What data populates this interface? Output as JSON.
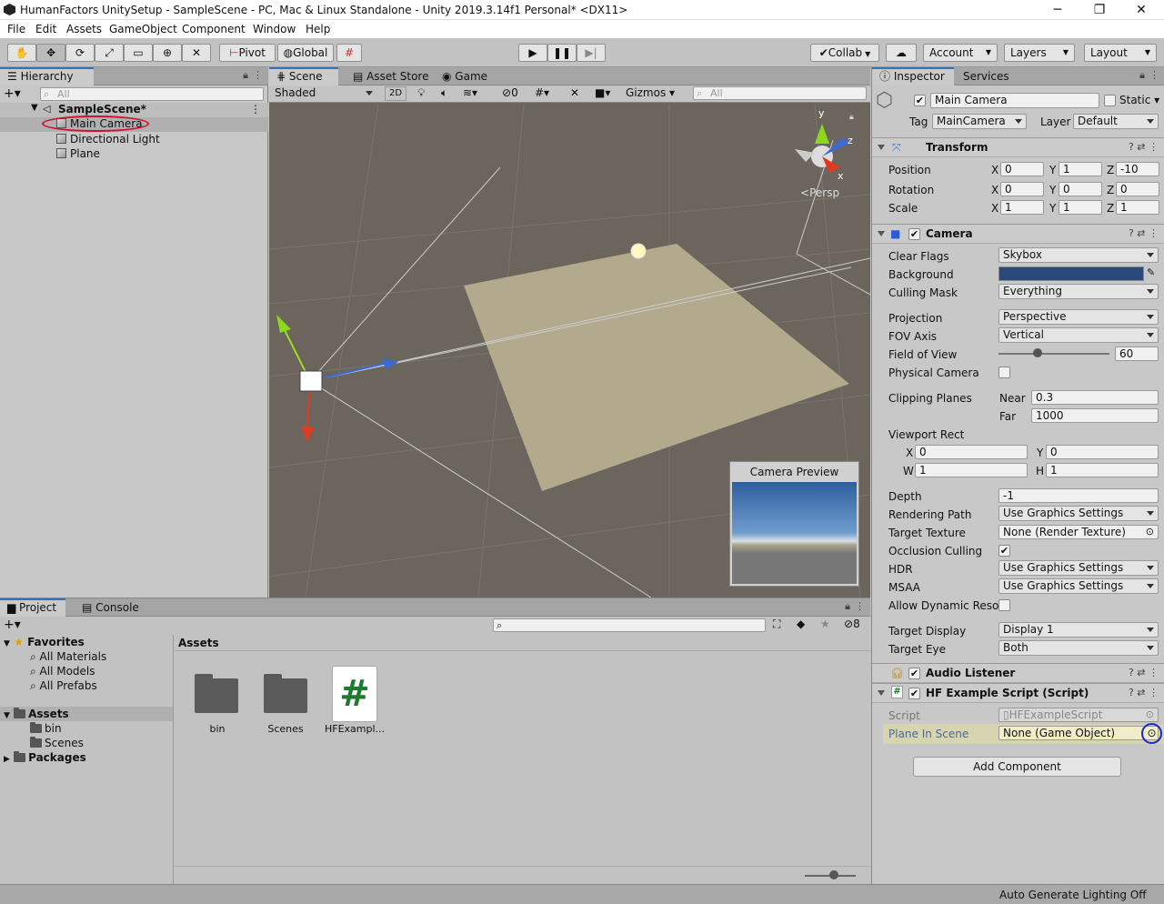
{
  "window": {
    "title": "HumanFactors UnitySetup - SampleScene - PC, Mac & Linux Standalone - Unity 2019.3.14f1 Personal* <DX11>",
    "minimize": "─",
    "maximize": "❐",
    "close": "✕"
  },
  "menu": [
    "File",
    "Edit",
    "Assets",
    "GameObject",
    "Component",
    "Window",
    "Help"
  ],
  "toolbar": {
    "pivot": "Pivot",
    "global": "Global",
    "collab": "Collab",
    "account": "Account",
    "layers": "Layers",
    "layout": "Layout"
  },
  "hierarchy": {
    "tab": "Hierarchy",
    "search_placeholder": "All",
    "scene": "SampleScene*",
    "items": [
      "Main Camera",
      "Directional Light",
      "Plane"
    ]
  },
  "scene_view": {
    "tabs": [
      "Scene",
      "Asset Store",
      "Game"
    ],
    "shading": "Shaded",
    "mode_2d": "2D",
    "hidden_count": "0",
    "gizmos": "Gizmos",
    "search_placeholder": "All",
    "persp": "Persp",
    "axis_y": "y",
    "axis_x": "x",
    "axis_z": "z",
    "camera_preview_title": "Camera Preview"
  },
  "project": {
    "tabs": [
      "Project",
      "Console"
    ],
    "hidden_count": "8",
    "favorites": "Favorites",
    "favorite_items": [
      "All Materials",
      "All Models",
      "All Prefabs"
    ],
    "assets_root": "Assets",
    "asset_folders": [
      "bin",
      "Scenes"
    ],
    "packages": "Packages",
    "breadcrumb": "Assets",
    "grid_items": [
      {
        "label": "bin",
        "kind": "folder"
      },
      {
        "label": "Scenes",
        "kind": "folder"
      },
      {
        "label": "HFExampl...",
        "kind": "script"
      }
    ]
  },
  "inspector": {
    "tabs": [
      "Inspector",
      "Services"
    ],
    "object_name": "Main Camera",
    "static_label": "Static",
    "tag_label": "Tag",
    "tag_value": "MainCamera",
    "layer_label": "Layer",
    "layer_value": "Default",
    "transform": {
      "title": "Transform",
      "position": {
        "label": "Position",
        "x": "0",
        "y": "1",
        "z": "-10"
      },
      "rotation": {
        "label": "Rotation",
        "x": "0",
        "y": "0",
        "z": "0"
      },
      "scale": {
        "label": "Scale",
        "x": "1",
        "y": "1",
        "z": "1"
      }
    },
    "camera": {
      "title": "Camera",
      "clear_flags_label": "Clear Flags",
      "clear_flags": "Skybox",
      "background_label": "Background",
      "background_color": "#2b4a7a",
      "culling_mask_label": "Culling Mask",
      "culling_mask": "Everything",
      "projection_label": "Projection",
      "projection": "Perspective",
      "fov_axis_label": "FOV Axis",
      "fov_axis": "Vertical",
      "fov_label": "Field of View",
      "fov": "60",
      "physical_label": "Physical Camera",
      "clipping_label": "Clipping Planes",
      "near_label": "Near",
      "near": "0.3",
      "far_label": "Far",
      "far": "1000",
      "viewport_label": "Viewport Rect",
      "vx": "0",
      "vy": "0",
      "vw": "1",
      "vh": "1",
      "depth_label": "Depth",
      "depth": "-1",
      "rendering_path_label": "Rendering Path",
      "rendering_path": "Use Graphics Settings",
      "target_texture_label": "Target Texture",
      "target_texture": "None (Render Texture)",
      "occlusion_label": "Occlusion Culling",
      "hdr_label": "HDR",
      "hdr": "Use Graphics Settings",
      "msaa_label": "MSAA",
      "msaa": "Use Graphics Settings",
      "dynamic_res_label": "Allow Dynamic Resol",
      "target_display_label": "Target Display",
      "target_display": "Display 1",
      "target_eye_label": "Target Eye",
      "target_eye": "Both"
    },
    "audio_listener": {
      "title": "Audio Listener"
    },
    "hf_script": {
      "title": "HF Example Script (Script)",
      "script_label": "Script",
      "script_value": "HFExampleScript",
      "plane_label": "Plane In Scene",
      "plane_value": "None (Game Object)"
    },
    "add_component": "Add Component"
  },
  "status": {
    "text": "Auto Generate Lighting Off"
  },
  "colors": {
    "accent": "#3a72b0",
    "selection": "#b0b0b0",
    "scene_bg": "#6b655e",
    "plane": "#b3a98c"
  }
}
